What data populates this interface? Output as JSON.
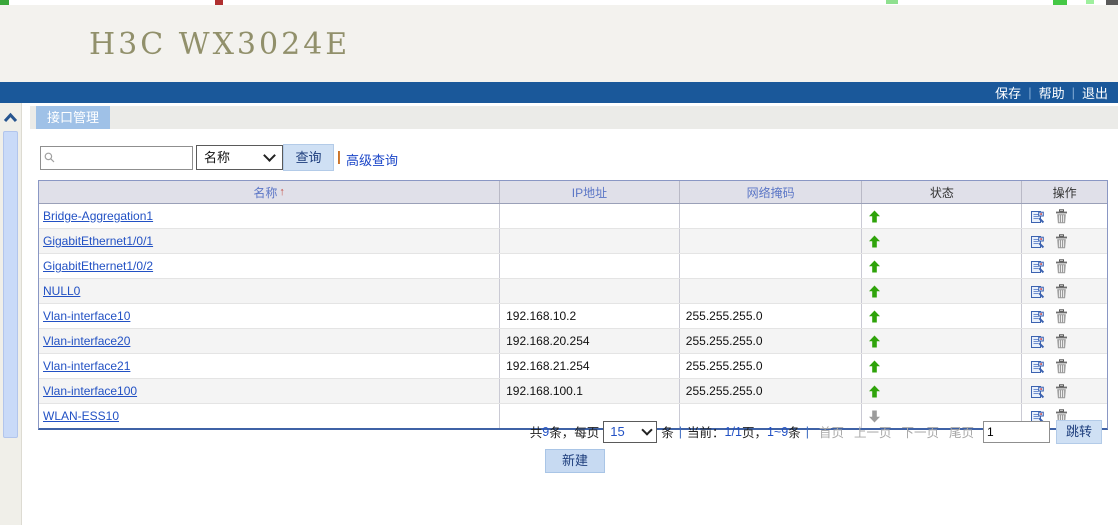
{
  "colors": {
    "topbar": "#1a589a",
    "tab_active": "#9fc1e7",
    "button_bg": "#cfe0f4",
    "button_text": "#1d3d7c",
    "link_blue": "#2251c4",
    "header_link_blue": "#5b76c6",
    "sort_arrow_red": "#c5524a",
    "status_up_green": "#2fa30a",
    "status_down_grey": "#9c9c9c",
    "brand_title_olive": "#91906b",
    "advanced_separator_orange": "#c86a1a"
  },
  "icons": {
    "search": "magnifier-icon",
    "collapse": "chevron-up-icon",
    "status_up": "green-up-arrow-icon",
    "status_down": "grey-down-arrow-icon",
    "edit": "edit-document-icon",
    "delete": "trash-icon"
  },
  "header": {
    "title": "H3C WX3024E",
    "separator": "|",
    "links": [
      "保存",
      "帮助",
      "退出"
    ]
  },
  "tab": {
    "label": "接口管理"
  },
  "search": {
    "input_value": "",
    "field_select_value": "名称",
    "query_button": "查询",
    "advanced_separator": "|",
    "advanced_link": "高级查询"
  },
  "table": {
    "columns": [
      {
        "label": "名称",
        "sort_arrow": "↑"
      },
      {
        "label": "IP地址"
      },
      {
        "label": "网络掩码"
      },
      {
        "label": "状态"
      },
      {
        "label": "操作"
      }
    ],
    "rows": [
      {
        "name": "Bridge-Aggregation1",
        "ip": "",
        "mask": "",
        "status": "up"
      },
      {
        "name": "GigabitEthernet1/0/1",
        "ip": "",
        "mask": "",
        "status": "up"
      },
      {
        "name": "GigabitEthernet1/0/2",
        "ip": "",
        "mask": "",
        "status": "up"
      },
      {
        "name": "NULL0",
        "ip": "",
        "mask": "",
        "status": "up"
      },
      {
        "name": "Vlan-interface10",
        "ip": "192.168.10.2",
        "mask": "255.255.255.0",
        "status": "up"
      },
      {
        "name": "Vlan-interface20",
        "ip": "192.168.20.254",
        "mask": "255.255.255.0",
        "status": "up"
      },
      {
        "name": "Vlan-interface21",
        "ip": "192.168.21.254",
        "mask": "255.255.255.0",
        "status": "up"
      },
      {
        "name": "Vlan-interface100",
        "ip": "192.168.100.1",
        "mask": "255.255.255.0",
        "status": "up"
      },
      {
        "name": "WLAN-ESS10",
        "ip": "",
        "mask": "",
        "status": "down"
      }
    ]
  },
  "pagination": {
    "total_prefix": "共",
    "total_count": "9",
    "total_mid": "条，每页",
    "page_size_value": "15",
    "after_select": "条",
    "separator": "|",
    "current_label": "当前：",
    "current_page": "1/1",
    "current_page_suffix": "页，",
    "current_range": "1~9",
    "current_range_suffix": "条",
    "first_label": "首页",
    "prev_label": "上一页",
    "next_label": "下一页",
    "last_label": "尾页",
    "jump_input_value": "1",
    "jump_button": "跳转"
  },
  "actions": {
    "new_button": "新建"
  }
}
